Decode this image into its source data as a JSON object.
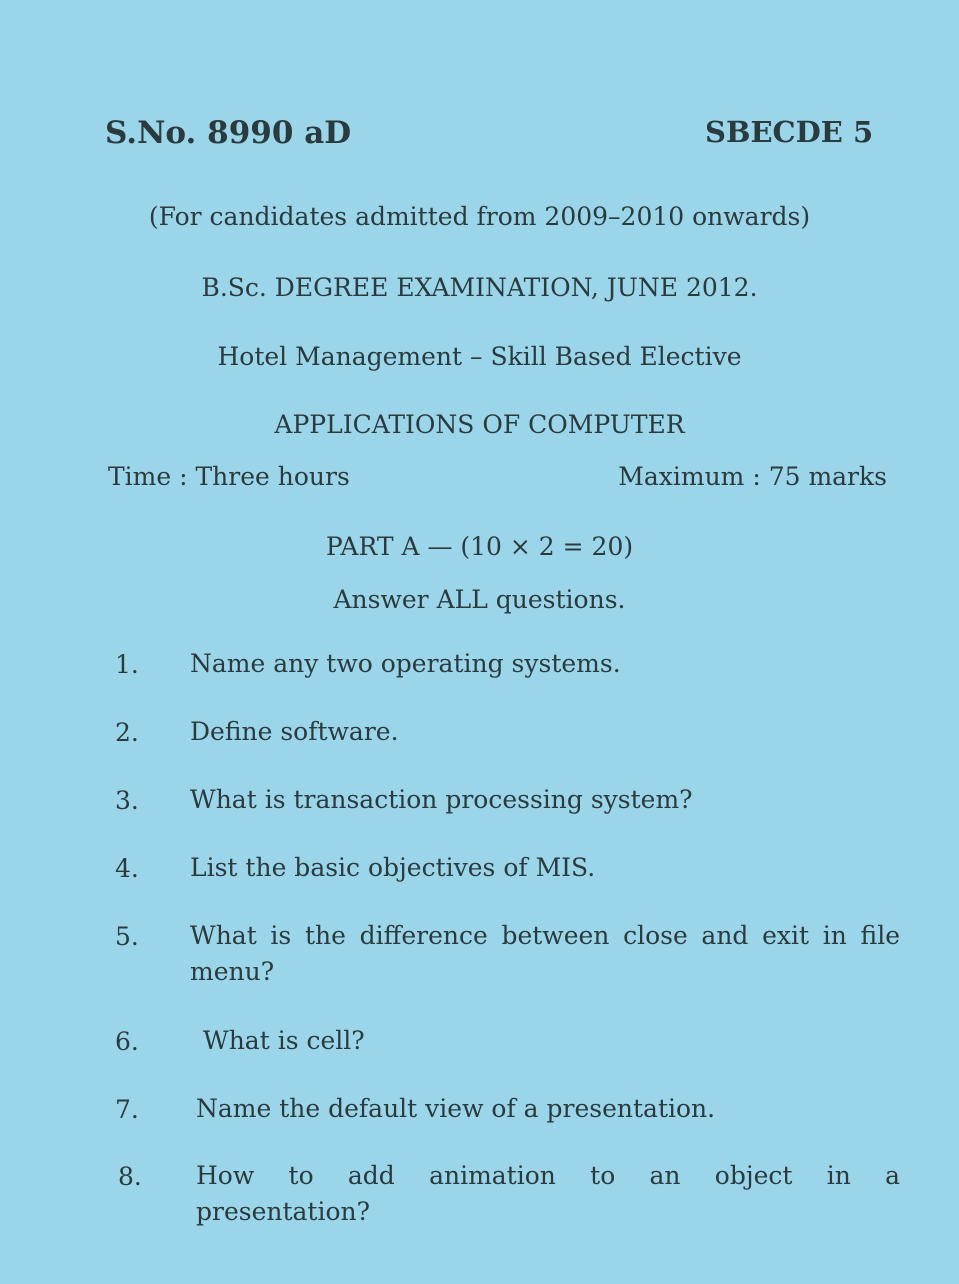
{
  "header": {
    "serial": "S.No. 8990 aD",
    "code": "SBECDE 5"
  },
  "eligibility": "(For candidates admitted from 2009–2010 onwards)",
  "exam": "B.Sc. DEGREE EXAMINATION, JUNE 2012.",
  "subject": "Hotel Management – Skill Based Elective",
  "paper": "APPLICATIONS OF COMPUTER",
  "time": "Time : Three hours",
  "max_marks": "Maximum : 75 marks",
  "part": "PART A — (10 × 2 = 20)",
  "instruction": "Answer ALL questions.",
  "questions": [
    {
      "num": "1.",
      "text": "Name any two operating systems."
    },
    {
      "num": "2.",
      "text": "Define software."
    },
    {
      "num": "3.",
      "text": "What is transaction processing system?"
    },
    {
      "num": "4.",
      "text": "List the basic objectives of MIS."
    },
    {
      "num": "5.",
      "text": "What is the difference between close and exit in file menu?"
    },
    {
      "num": "6.",
      "text": "What is cell?"
    },
    {
      "num": "7.",
      "text": "Name the default view of a presentation."
    },
    {
      "num": "8.",
      "text": "How to add animation to an object in a presentation?"
    }
  ]
}
